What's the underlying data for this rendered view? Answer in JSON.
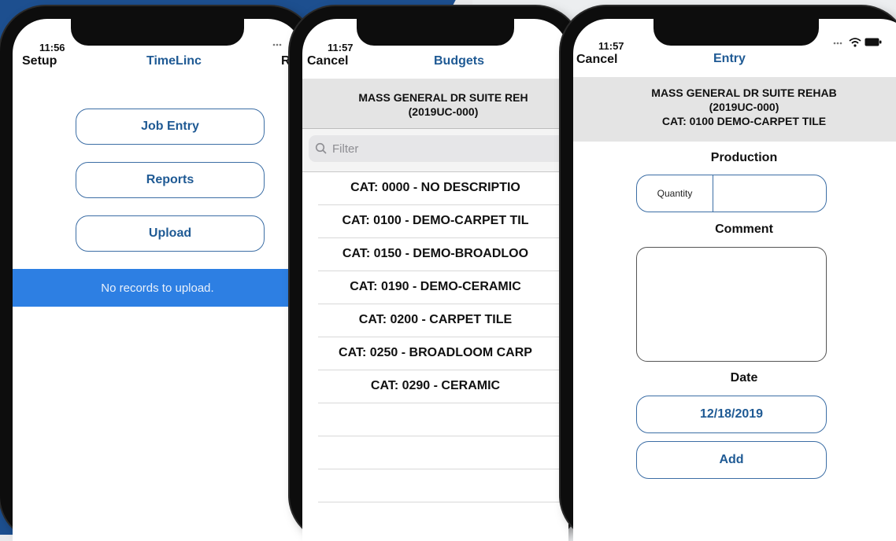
{
  "phone1": {
    "time": "11:56",
    "nav_left": "Setup",
    "nav_title": "TimeLinc",
    "nav_right": "R",
    "buttons": [
      {
        "label": "Job Entry"
      },
      {
        "label": "Reports"
      },
      {
        "label": "Upload"
      }
    ],
    "status_message": "No records to upload."
  },
  "phone2": {
    "time": "11:57",
    "nav_left": "Cancel",
    "nav_title": "Budgets",
    "header_line1": "MASS GENERAL DR SUITE REH",
    "header_line2": "(2019UC-000)",
    "filter_placeholder": "Filter",
    "items": [
      {
        "label": "CAT: 0000 - NO DESCRIPTIO"
      },
      {
        "label": "CAT: 0100 - DEMO-CARPET TIL"
      },
      {
        "label": "CAT: 0150 - DEMO-BROADLOO"
      },
      {
        "label": "CAT: 0190 - DEMO-CERAMIC"
      },
      {
        "label": "CAT: 0200 - CARPET TILE"
      },
      {
        "label": "CAT: 0250 - BROADLOOM CARP"
      },
      {
        "label": "CAT: 0290 - CERAMIC"
      }
    ]
  },
  "phone3": {
    "time": "11:57",
    "nav_left": "Cancel",
    "nav_title": "Entry",
    "header_line1": "MASS GENERAL DR SUITE REHAB",
    "header_line2": "(2019UC-000)",
    "header_line3": "CAT: 0100 DEMO-CARPET TILE",
    "production_label": "Production",
    "quantity_label": "Quantity",
    "comment_label": "Comment",
    "date_label": "Date",
    "date_value": "12/18/2019",
    "add_label": "Add"
  },
  "colors": {
    "accent": "#1f5a94",
    "status_bar": "#2d7fe3",
    "background_blue": "#1d4f8f"
  },
  "icons": {
    "filter": "magnifier-icon",
    "wifi": "wifi-icon",
    "battery": "battery-icon",
    "signal": "signal-dots-icon"
  }
}
